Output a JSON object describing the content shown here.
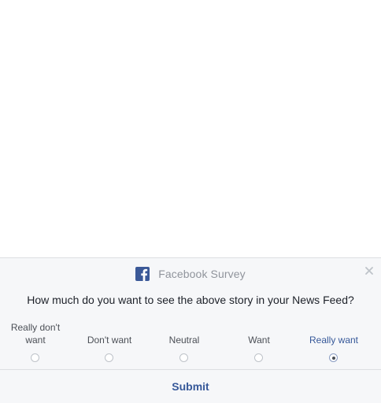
{
  "survey": {
    "title": "Facebook Survey",
    "question": "How much do you want to see the above story in your News Feed?",
    "options": [
      {
        "label": "Really don't want",
        "selected": false
      },
      {
        "label": "Don't want",
        "selected": false
      },
      {
        "label": "Neutral",
        "selected": false
      },
      {
        "label": "Want",
        "selected": false
      },
      {
        "label": "Really want",
        "selected": true
      }
    ],
    "submit_label": "Submit"
  },
  "icons": {
    "logo": "facebook-f-icon",
    "close": "close-icon"
  },
  "colors": {
    "brand": "#3b5998",
    "link": "#365899",
    "panel_background": "#f6f7f9",
    "border": "#dddfe2"
  }
}
